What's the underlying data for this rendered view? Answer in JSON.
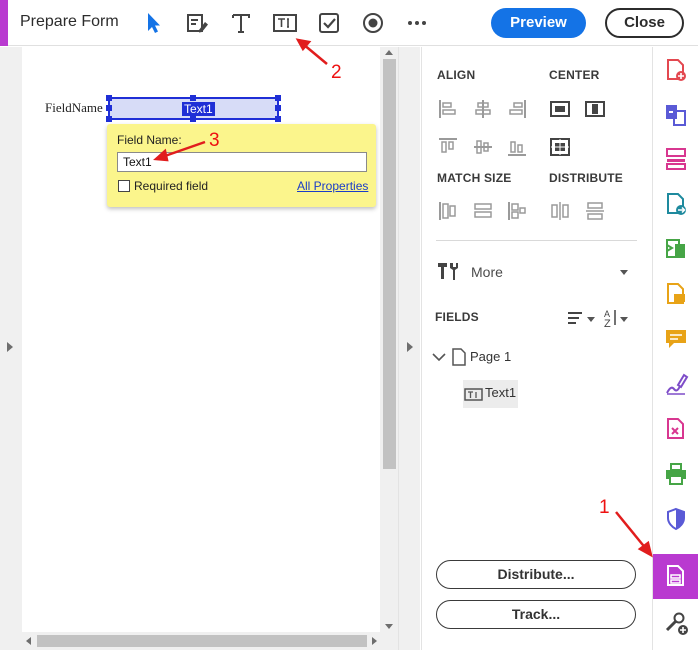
{
  "toolbar": {
    "title": "Prepare Form",
    "preview_label": "Preview",
    "close_label": "Close",
    "tools": [
      "select-pointer-icon",
      "edit-form-icon",
      "add-text-icon",
      "text-field-icon",
      "checkbox-icon",
      "radio-button-icon",
      "more-options-icon"
    ]
  },
  "document": {
    "field_label": "FieldName",
    "field_name_tag": "Text1"
  },
  "popup": {
    "field_name_label": "Field Name:",
    "field_name_value": "Text1",
    "required_label": "Required field",
    "required_checked": false,
    "all_properties_label": "All Properties"
  },
  "panel": {
    "align_title": "ALIGN",
    "center_title": "CENTER",
    "match_size_title": "MATCH SIZE",
    "distribute_title": "DISTRIBUTE",
    "more_label": "More",
    "fields_title": "FIELDS",
    "page_label": "Page 1",
    "field_item": "Text1",
    "distribute_button": "Distribute...",
    "track_button": "Track..."
  },
  "rail": {
    "active_index": 13,
    "icons": [
      "create-pdf-icon",
      "combine-files-icon",
      "organize-pages-icon",
      "export-pdf-icon",
      "edit-pdf-icon",
      "comment-icon",
      "comment-bubble-icon",
      "fill-sign-icon",
      "compress-pdf-icon",
      "print-production-icon",
      "protect-icon",
      "prepare-form-icon",
      "more-tools-icon"
    ]
  },
  "annotations": {
    "marker_1": "1",
    "marker_2": "2",
    "marker_3": "3",
    "color": "#e11d1d"
  },
  "colors": {
    "accent": "#b93ad0",
    "preview_blue": "#1473e6",
    "field_blue": "#1f2fd6",
    "popup_yellow": "#fbf58c"
  }
}
